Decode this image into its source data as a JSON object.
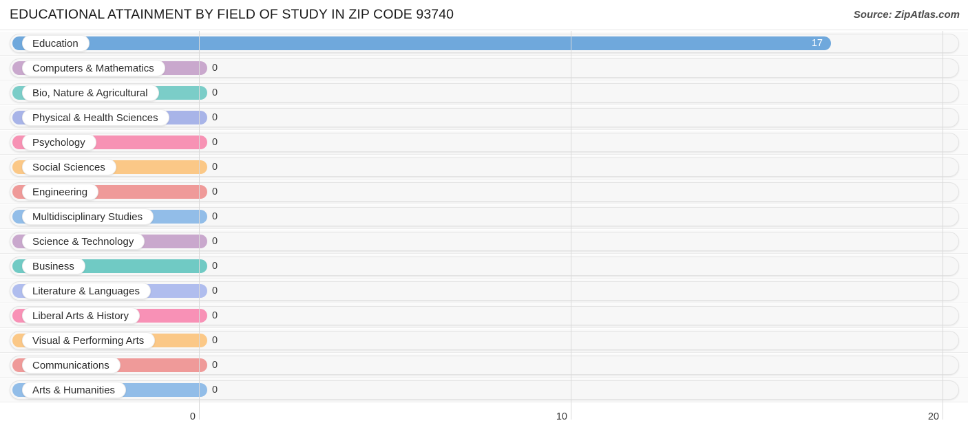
{
  "header": {
    "title": "EDUCATIONAL ATTAINMENT BY FIELD OF STUDY IN ZIP CODE 93740",
    "source": "Source: ZipAtlas.com"
  },
  "chart_data": {
    "type": "bar",
    "orientation": "horizontal",
    "title": "EDUCATIONAL ATTAINMENT BY FIELD OF STUDY IN ZIP CODE 93740",
    "subtitle": "",
    "xlabel": "",
    "ylabel": "",
    "xlim": [
      0,
      20
    ],
    "xticks": [
      0,
      10,
      20
    ],
    "xtick_labels": [
      "0",
      "10",
      "20"
    ],
    "grid": true,
    "legend": false,
    "categories": [
      "Education",
      "Computers & Mathematics",
      "Bio, Nature & Agricultural",
      "Physical & Health Sciences",
      "Psychology",
      "Social Sciences",
      "Engineering",
      "Multidisciplinary Studies",
      "Science & Technology",
      "Business",
      "Literature & Languages",
      "Liberal Arts & History",
      "Visual & Performing Arts",
      "Communications",
      "Arts & Humanities"
    ],
    "values": [
      17,
      0,
      0,
      0,
      0,
      0,
      0,
      0,
      0,
      0,
      0,
      0,
      0,
      0,
      0
    ],
    "value_labels": [
      "17",
      "0",
      "0",
      "0",
      "0",
      "0",
      "0",
      "0",
      "0",
      "0",
      "0",
      "0",
      "0",
      "0",
      "0"
    ],
    "colors": [
      "#6fa8dc",
      "#c9a8cd",
      "#7bcdc8",
      "#a8b4e8",
      "#f792b4",
      "#fbc887",
      "#ef9a99",
      "#92bde8",
      "#c9a8cd",
      "#70cac4",
      "#b0bdee",
      "#f891b6",
      "#fbc887",
      "#ef9a99",
      "#92bde8"
    ]
  }
}
